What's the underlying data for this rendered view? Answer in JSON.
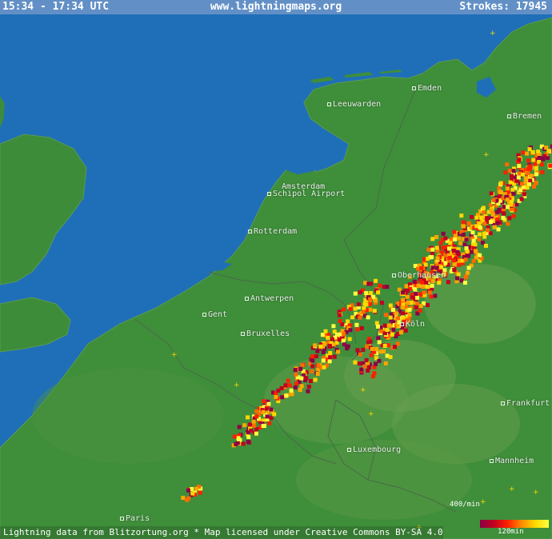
{
  "header": {
    "time_range": "15:34 - 17:34 UTC",
    "site": "www.lightningmaps.org",
    "strokes_label": "Strokes: 17945"
  },
  "footer": {
    "credit": "Lightning data from Blitzortung.org  *  Map licensed under Creative Commons BY-SA 4.0"
  },
  "legend": {
    "rate": "400/min",
    "time": "120min"
  },
  "colors": {
    "sea": "#1f6fb8",
    "land": "#3d8c3a",
    "strike_old": "#8b0046",
    "strike_new": "#ffff40"
  },
  "cities": [
    {
      "id": "emden",
      "name": "Emden"
    },
    {
      "id": "leeuwarden",
      "name": "Leeuwarden"
    },
    {
      "id": "bremen",
      "name": "Bremen"
    },
    {
      "id": "amsterdam",
      "name": "Amsterdam"
    },
    {
      "id": "schiphol",
      "name": "Schipol Airport"
    },
    {
      "id": "rotterdam",
      "name": "Rotterdam"
    },
    {
      "id": "oberhausen",
      "name": "Oberhausen"
    },
    {
      "id": "antwerpen",
      "name": "Antwerpen"
    },
    {
      "id": "gent",
      "name": "Gent"
    },
    {
      "id": "bruxelles",
      "name": "Bruxelles"
    },
    {
      "id": "koln",
      "name": "Köln"
    },
    {
      "id": "frankfurt",
      "name": "Frankfurt"
    },
    {
      "id": "luxembourg",
      "name": "Luxembourg"
    },
    {
      "id": "mannheim",
      "name": "Mannheim"
    },
    {
      "id": "paris",
      "name": "Paris"
    }
  ]
}
